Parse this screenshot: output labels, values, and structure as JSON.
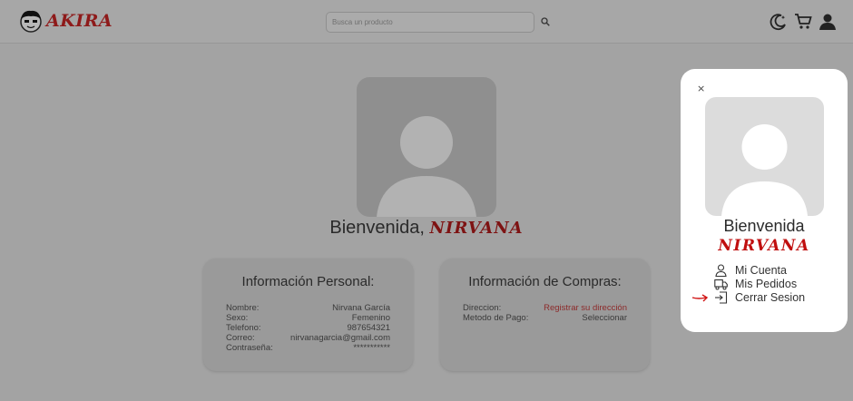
{
  "header": {
    "logo_text": "AKIRA",
    "search_placeholder": "Busca un producto",
    "icons": [
      "moon-icon",
      "cart-icon",
      "user-icon"
    ]
  },
  "profile": {
    "welcome_prefix": "Bienvenida,",
    "name": "NIRVANA"
  },
  "personal_card": {
    "title": "Información Personal:",
    "rows": [
      {
        "label": "Nombre:",
        "value": "Nirvana García"
      },
      {
        "label": "Sexo:",
        "value": "Femenino"
      },
      {
        "label": "Telefono:",
        "value": "987654321"
      },
      {
        "label": "Correo:",
        "value": "nirvanagarcia@gmail.com"
      },
      {
        "label": "Contraseña:",
        "value": "***********"
      }
    ]
  },
  "purchase_card": {
    "title": "Información de Compras:",
    "rows": [
      {
        "label": "Direccion:",
        "value": "Registrar su dirección"
      },
      {
        "label": "Metodo de Pago:",
        "value": "Seleccionar"
      }
    ]
  },
  "panel": {
    "close_label": "×",
    "welcome": "Bienvenida",
    "name": "NIRVANA",
    "menu": [
      {
        "label": "Mi Cuenta",
        "icon": "person-icon"
      },
      {
        "label": "Mis Pedidos",
        "icon": "truck-icon"
      },
      {
        "label": "Cerrar Sesion",
        "icon": "logout-icon"
      }
    ]
  },
  "colors": {
    "overlay": "#a3a3a3",
    "brand_red": "#c00f0f",
    "panel_bg": "#ffffff"
  }
}
